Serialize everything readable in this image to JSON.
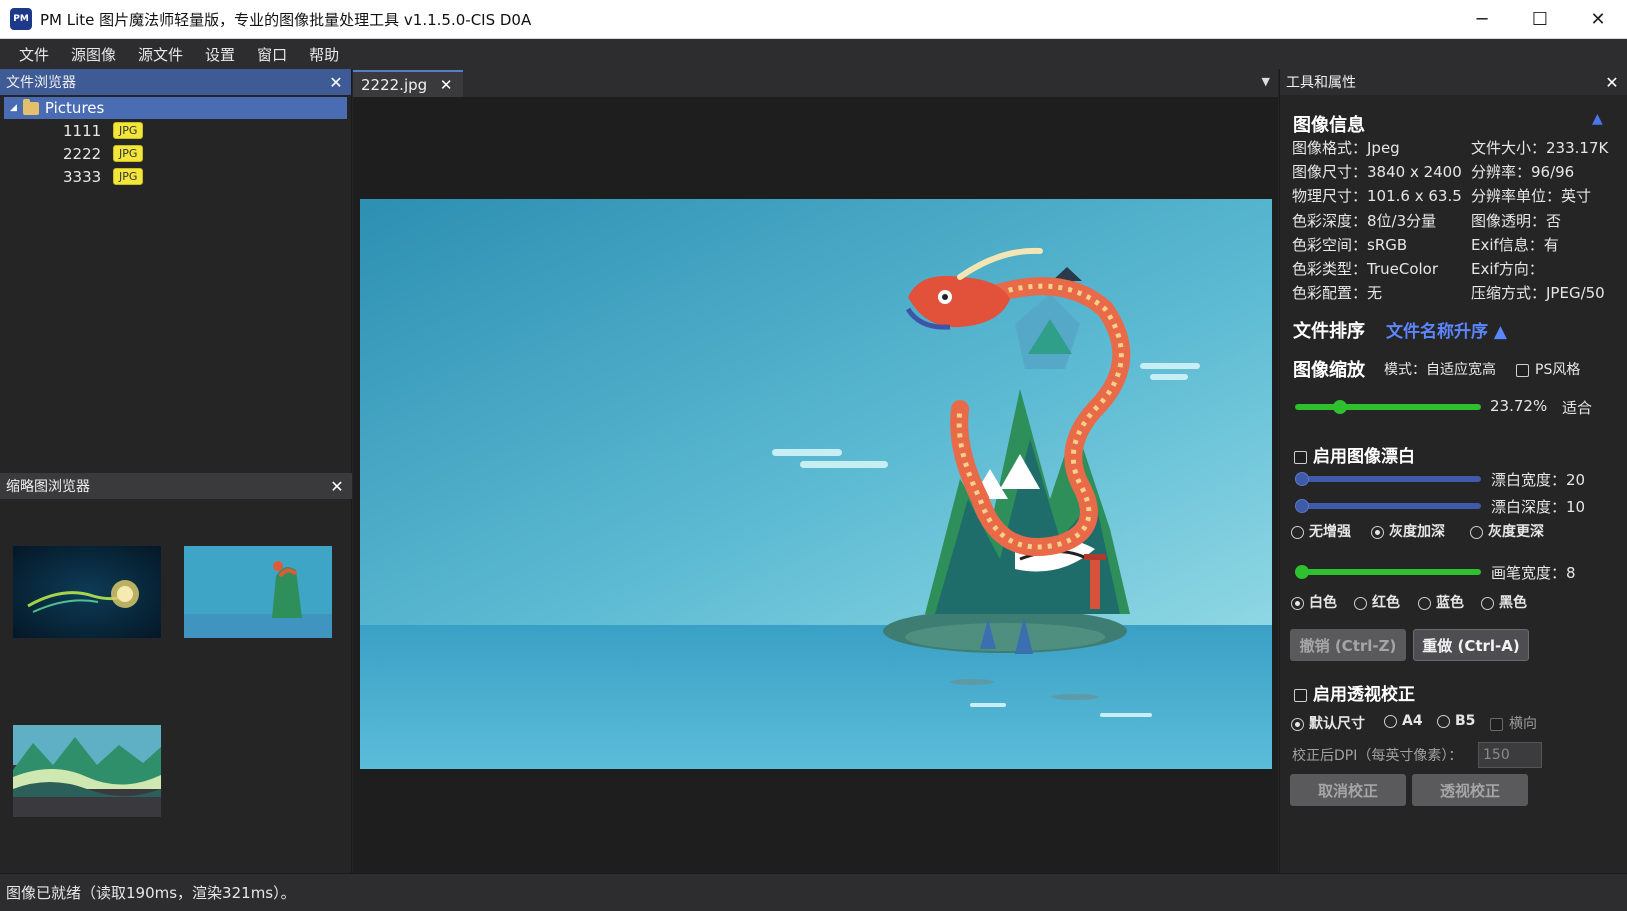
{
  "window": {
    "title": "PM Lite 图片魔法师轻量版，专业的图像批量处理工具 v1.1.5.0-CIS D0A",
    "icon_text": "PM",
    "minimize": "─",
    "maximize": "☐",
    "close": "✕"
  },
  "menu": [
    "文件",
    "源图像",
    "源文件",
    "设置",
    "窗口",
    "帮助"
  ],
  "file_browser": {
    "title": "文件浏览器",
    "root": "Pictures",
    "files": [
      {
        "name": "1111",
        "badge": "JPG"
      },
      {
        "name": "2222",
        "badge": "JPG"
      },
      {
        "name": "3333",
        "badge": "JPG"
      }
    ]
  },
  "thumbnail_browser": {
    "title": "缩略图浏览器"
  },
  "document": {
    "tab": "2222.jpg"
  },
  "tools": {
    "title": "工具和属性",
    "image_info": {
      "title": "图像信息",
      "format": "图像格式：Jpeg",
      "file_size": "文件大小：233.17K",
      "dimensions": "图像尺寸：3840 x 2400",
      "resolution": "分辨率：96/96",
      "physical": "物理尺寸：101.6 x 63.5",
      "res_unit": "分辨率单位：英寸",
      "depth": "色彩深度：8位/3分量",
      "transparency": "图像透明：否",
      "colorspace": "色彩空间：sRGB",
      "exif": "Exif信息：有",
      "colortype": "色彩类型：TrueColor",
      "exif_orient": "Exif方向：",
      "profile": "色彩配置：无",
      "compression": "压缩方式：JPEG/50"
    },
    "sort": {
      "title": "文件排序",
      "value": "文件名称升序 ▲"
    },
    "zoom": {
      "title": "图像缩放",
      "mode": "模式：自适应宽高",
      "ps_style": "PS风格",
      "percent": "23.72%",
      "fit": "适合",
      "level": 0.24
    },
    "whiten": {
      "enable": "启用图像漂白",
      "width_label": "漂白宽度：20",
      "depth_label": "漂白深度：10",
      "opt_none": "无增强",
      "opt_gray_deep": "灰度加深",
      "opt_gray_more": "灰度更深",
      "brush_label": "画笔宽度：8",
      "color_white": "白色",
      "color_red": "红色",
      "color_blue": "蓝色",
      "color_black": "黑色",
      "undo": "撤销 (Ctrl-Z)",
      "redo": "重做 (Ctrl-A)"
    },
    "perspective": {
      "enable": "启用透视校正",
      "opt_default": "默认尺寸",
      "opt_a4": "A4",
      "opt_b5": "B5",
      "landscape": "横向",
      "dpi_label": "校正后DPI（每英寸像素）：",
      "dpi_value": "150",
      "cancel": "取消校正",
      "apply": "透视校正"
    }
  },
  "status": "图像已就绪（读取190ms，渲染321ms）。",
  "colors": {
    "accent_blue": "#4a6cb3",
    "slider_green": "#2ec02e",
    "slider_blue": "#3e5aa8",
    "sort_link": "#5b86ff"
  }
}
